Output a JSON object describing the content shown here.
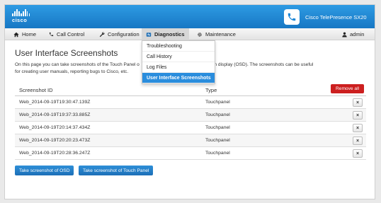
{
  "header": {
    "logo_text": "cisco",
    "product_name": "Cisco TelePresence SX20",
    "colors": {
      "brand": "#1f87d6",
      "danger": "#cc1f1f",
      "selected": "#2a8ddd"
    }
  },
  "nav": {
    "home": "Home",
    "call_control": "Call Control",
    "configuration": "Configuration",
    "diagnostics": "Diagnostics",
    "maintenance": "Maintenance",
    "user": "admin"
  },
  "dropdown": {
    "items": [
      "Troubleshooting",
      "Call History",
      "Log Files",
      "User Interface Screenshots"
    ],
    "selected": "User Interface Screenshots"
  },
  "page": {
    "title": "User Interface Screenshots",
    "description_line1_left": "On this page you can take screenshots of the Touch Panel o",
    "description_line1_right": "ace and the on screen display (OSD). The screenshots can be useful",
    "description_line2": "for creating user manuals, reporting bugs to Cisco, etc."
  },
  "table": {
    "col_id": "Screenshot ID",
    "col_type": "Type",
    "remove_all": "Remove all",
    "remove_glyph": "×",
    "rows": [
      {
        "id": "Web_2014-09-19T19:30:47.139Z",
        "type": "Touchpanel"
      },
      {
        "id": "Web_2014-09-19T19:37:33.885Z",
        "type": "Touchpanel"
      },
      {
        "id": "Web_2014-09-19T20:14:37.434Z",
        "type": "Touchpanel"
      },
      {
        "id": "Web_2014-09-19T20:20:23.473Z",
        "type": "Touchpanel"
      },
      {
        "id": "Web_2014-09-19T20:28:36.247Z",
        "type": "Touchpanel"
      }
    ]
  },
  "actions": {
    "osd": "Take screenshot of OSD",
    "touch_panel": "Take screenshot of Touch Panel"
  }
}
